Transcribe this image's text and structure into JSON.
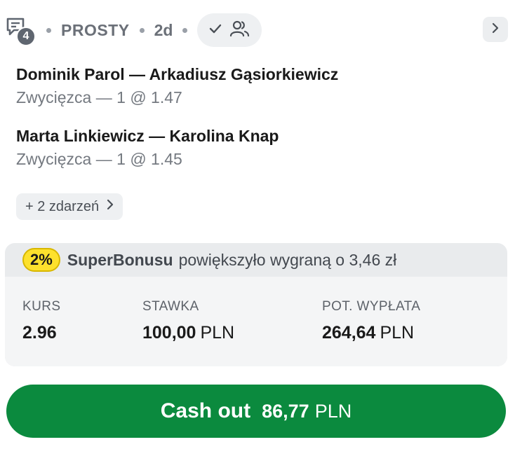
{
  "header": {
    "selection_count": "4",
    "bet_type": "PROSTY",
    "age": "2d",
    "icons": {
      "bet": "bet-slip-icon",
      "check": "check-icon",
      "people": "people-icon",
      "next": "chevron-right-icon"
    }
  },
  "selections": [
    {
      "event": "Dominik Parol — Arkadiusz Gąsiorkiewicz",
      "market": "Zwycięzca — 1 @ 1.47"
    },
    {
      "event": "Marta Linkiewicz — Karolina Knap",
      "market": "Zwycięzca — 1 @ 1.45"
    }
  ],
  "more_events": {
    "label": "+ 2 zdarzeń",
    "icon": "chevron-right-icon"
  },
  "bonus": {
    "percent": "2%",
    "name": "SuperBonusu",
    "text": "powiększyło wygraną o 3,46 zł"
  },
  "stats": {
    "odds_label": "KURS",
    "odds_value": "2.96",
    "stake_label": "STAWKA",
    "stake_value": "100,00",
    "stake_currency": "PLN",
    "payout_label": "POT. WYPŁATA",
    "payout_value": "264,64",
    "payout_currency": "PLN"
  },
  "cashout": {
    "label": "Cash out",
    "amount": "86,77",
    "currency": "PLN"
  },
  "colors": {
    "cashout_green": "#0b8a3e",
    "bonus_yellow": "#fde12d",
    "badge_gray": "#5f6670"
  }
}
